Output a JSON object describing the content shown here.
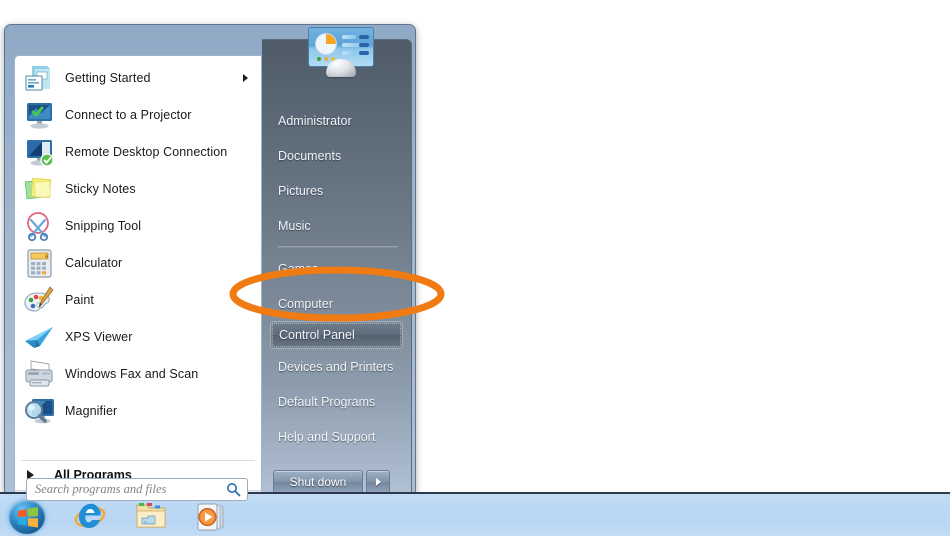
{
  "desktop": {
    "background_color": "#ffffff"
  },
  "start_menu": {
    "left_pane": {
      "programs": [
        {
          "label": "Getting Started",
          "icon": "getting-started-icon",
          "has_submenu": true
        },
        {
          "label": "Connect to a Projector",
          "icon": "projector-icon",
          "has_submenu": false
        },
        {
          "label": "Remote Desktop Connection",
          "icon": "remote-desktop-icon",
          "has_submenu": false
        },
        {
          "label": "Sticky Notes",
          "icon": "sticky-notes-icon",
          "has_submenu": false
        },
        {
          "label": "Snipping Tool",
          "icon": "snipping-tool-icon",
          "has_submenu": false
        },
        {
          "label": "Calculator",
          "icon": "calculator-icon",
          "has_submenu": false
        },
        {
          "label": "Paint",
          "icon": "paint-icon",
          "has_submenu": false
        },
        {
          "label": "XPS Viewer",
          "icon": "xps-viewer-icon",
          "has_submenu": false
        },
        {
          "label": "Windows Fax and Scan",
          "icon": "fax-scan-icon",
          "has_submenu": false
        },
        {
          "label": "Magnifier",
          "icon": "magnifier-icon",
          "has_submenu": false
        }
      ],
      "all_programs": {
        "label": "All Programs",
        "icon": "right-arrow-icon"
      },
      "search": {
        "placeholder": "Search programs and files",
        "value": "",
        "icon": "search-magnifier-icon"
      }
    },
    "right_pane": {
      "user_picture": {
        "icon": "control-panel-user-picture"
      },
      "items": [
        {
          "label": "Administrator",
          "selected": false,
          "separator_after": false
        },
        {
          "label": "Documents",
          "selected": false,
          "separator_after": false
        },
        {
          "label": "Pictures",
          "selected": false,
          "separator_after": false
        },
        {
          "label": "Music",
          "selected": false,
          "separator_after": true
        },
        {
          "label": "Games",
          "selected": false,
          "separator_after": false
        },
        {
          "label": "Computer",
          "selected": false,
          "separator_after": false
        },
        {
          "label": "Control Panel",
          "selected": true,
          "separator_after": false
        },
        {
          "label": "Devices and Printers",
          "selected": false,
          "separator_after": false
        },
        {
          "label": "Default Programs",
          "selected": false,
          "separator_after": false
        },
        {
          "label": "Help and Support",
          "selected": false,
          "separator_after": false
        }
      ],
      "shutdown": {
        "label": "Shut down",
        "arrow_icon": "right-triangle-icon"
      }
    }
  },
  "annotation": {
    "shape": "ellipse",
    "color": "#F07B13",
    "target": "Control Panel",
    "stroke_width": 7
  },
  "taskbar": {
    "start_button": {
      "name": "Start",
      "icon": "windows-orb-icon"
    },
    "pinned": [
      {
        "name": "Internet Explorer",
        "icon": "internet-explorer-icon"
      },
      {
        "name": "Windows Explorer",
        "icon": "windows-explorer-folder-icon"
      },
      {
        "name": "Windows Media Player",
        "icon": "windows-media-player-icon"
      }
    ]
  }
}
